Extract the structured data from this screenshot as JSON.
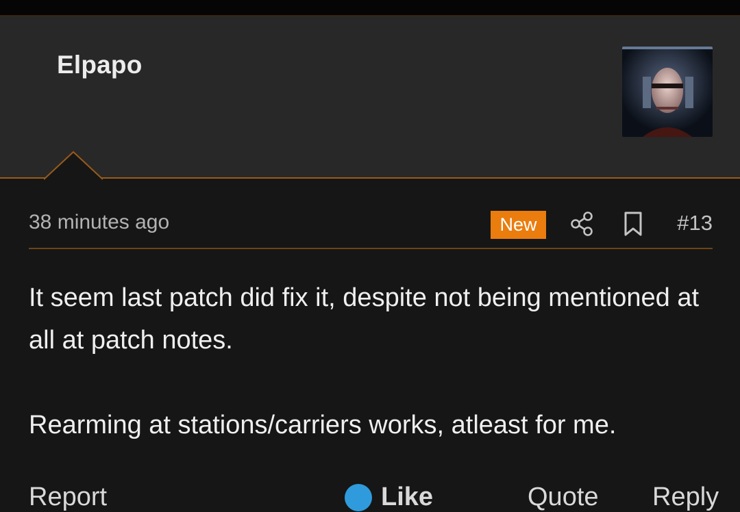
{
  "post": {
    "username": "Elpapo",
    "timestamp": "38 minutes ago",
    "badge": "New",
    "number": "#13",
    "body": [
      "It seem last patch did fix it, despite not being mentioned at all at patch notes.",
      "Rearming at stations/carriers works, atleast for me."
    ]
  },
  "footer": {
    "report": "Report",
    "like": "Like",
    "quote": "Quote",
    "reply": "Reply"
  },
  "icons": {
    "share": "share-icon",
    "bookmark": "bookmark-icon",
    "like": "like-icon",
    "quote": "quote-icon",
    "reply": "reply-icon"
  },
  "colors": {
    "accent": "#ea7d0e",
    "panel": "#282828",
    "background": "#161616",
    "divider": "#6e4315",
    "like": "#2f9bdc"
  }
}
